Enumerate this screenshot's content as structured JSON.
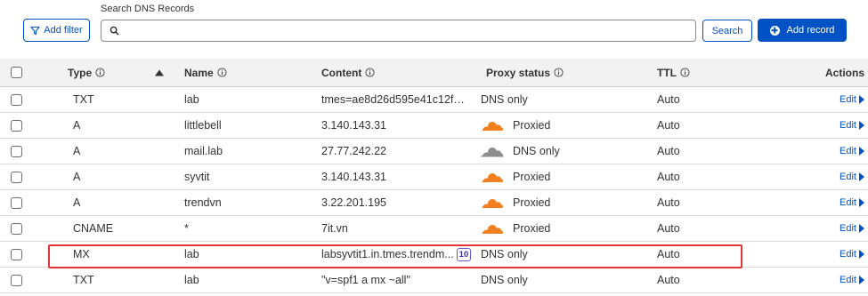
{
  "toolbar": {
    "filter_label": "Add filter",
    "search_label": "Search DNS Records",
    "search_value": "",
    "search_placeholder": "",
    "search_button": "Search",
    "add_record_label": "Add record"
  },
  "table": {
    "columns": {
      "type": "Type",
      "name": "Name",
      "content": "Content",
      "proxy": "Proxy status",
      "ttl": "TTL",
      "actions": "Actions"
    },
    "edit_label": "Edit",
    "rows": [
      {
        "type": "TXT",
        "name": "lab",
        "content": "tmes=ae8d26d595e41c12f7...",
        "badge": "",
        "proxy": "DNS only",
        "proxy_icon": "none",
        "ttl": "Auto"
      },
      {
        "type": "A",
        "name": "littlebell",
        "content": "3.140.143.31",
        "badge": "",
        "proxy": "Proxied",
        "proxy_icon": "cloud-orange",
        "ttl": "Auto"
      },
      {
        "type": "A",
        "name": "mail.lab",
        "content": "27.77.242.22",
        "badge": "",
        "proxy": "DNS only",
        "proxy_icon": "cloud-gray",
        "ttl": "Auto"
      },
      {
        "type": "A",
        "name": "syvtit",
        "content": "3.140.143.31",
        "badge": "",
        "proxy": "Proxied",
        "proxy_icon": "cloud-orange",
        "ttl": "Auto"
      },
      {
        "type": "A",
        "name": "trendvn",
        "content": "3.22.201.195",
        "badge": "",
        "proxy": "Proxied",
        "proxy_icon": "cloud-orange",
        "ttl": "Auto"
      },
      {
        "type": "CNAME",
        "name": "*",
        "content": "7it.vn",
        "badge": "",
        "proxy": "Proxied",
        "proxy_icon": "cloud-orange",
        "ttl": "Auto"
      },
      {
        "type": "MX",
        "name": "lab",
        "content": "labsyvtit1.in.tmes.trendm...",
        "badge": "10",
        "proxy": "DNS only",
        "proxy_icon": "none",
        "ttl": "Auto"
      },
      {
        "type": "TXT",
        "name": "lab",
        "content": "\"v=spf1 a mx ~all\"",
        "badge": "",
        "proxy": "DNS only",
        "proxy_icon": "none",
        "ttl": "Auto"
      }
    ]
  },
  "colors": {
    "accent": "#0051c3",
    "cloud_orange": "#f38020",
    "cloud_gray": "#8d8d8d",
    "highlight": "#e03535",
    "header_bg": "#f2f2f2"
  }
}
